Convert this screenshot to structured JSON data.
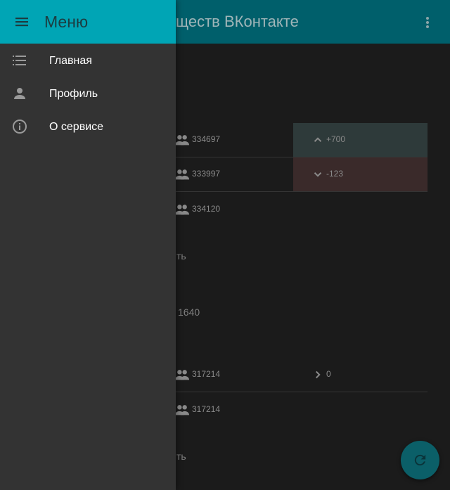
{
  "appbar": {
    "title": "ществ ВКонтакте",
    "more_icon": "more-vert-icon"
  },
  "colors": {
    "drawer_header": "#00a5b5",
    "drawer_bg": "#333333",
    "appbar_dimmed": "#005f6b",
    "up_cell": "#2e3a3a",
    "down_cell": "#3a2a2a"
  },
  "groups": {
    "rows": [
      {
        "count": "334697",
        "delta": "+700",
        "trend": "up"
      },
      {
        "count": "333997",
        "delta": "-123",
        "trend": "down"
      },
      {
        "count": "334120",
        "delta": "",
        "trend": "none"
      }
    ],
    "fragment_1": "ть",
    "fragment_2": "1640",
    "rows2": [
      {
        "count": "317214",
        "delta": "0",
        "trend": "right"
      },
      {
        "count": "317214",
        "delta": "",
        "trend": "none"
      }
    ],
    "fragment_3": "ть"
  },
  "fab": {
    "icon": "refresh-icon"
  },
  "drawer": {
    "title": "Меню",
    "menu_icon": "menu-icon",
    "items": [
      {
        "label": "Главная",
        "icon": "list-icon"
      },
      {
        "label": "Профиль",
        "icon": "person-icon"
      },
      {
        "label": "О сервисе",
        "icon": "info-icon"
      }
    ]
  }
}
